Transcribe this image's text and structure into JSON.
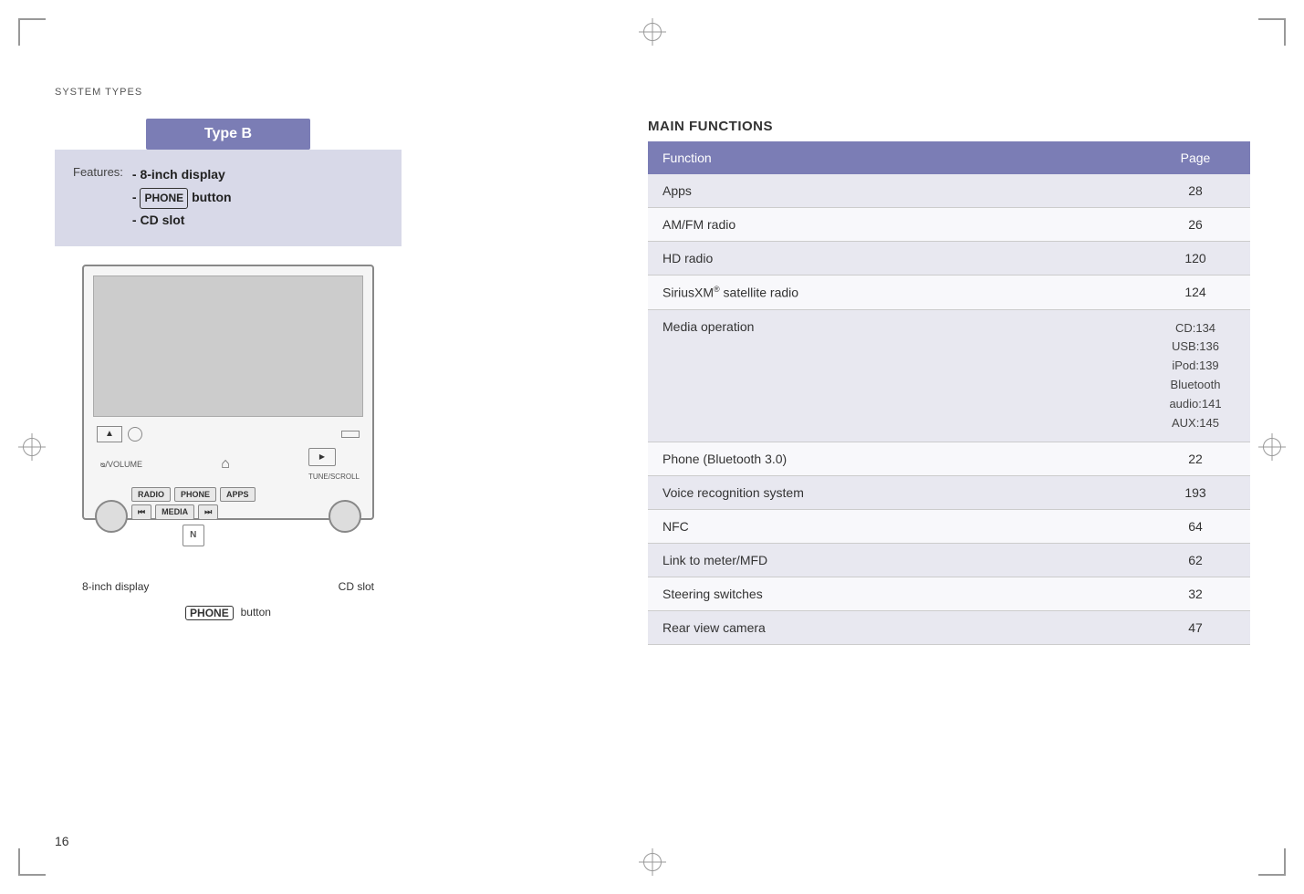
{
  "page": {
    "system_types_label": "SYSTEM TYPES",
    "page_number": "16"
  },
  "left_panel": {
    "type_b_label": "Type B",
    "features_label": "Features:",
    "feature_1": "- 8-inch display",
    "feature_2_pre": "-",
    "feature_2_badge": "PHONE",
    "feature_2_post": "button",
    "feature_3": "- CD slot",
    "controls": {
      "vol_label": "ᴓ/VOLUME",
      "tune_scroll": "TUNE/SCROLL",
      "radio_btn": "RADIO",
      "phone_btn": "PHONE",
      "apps_btn": "APPS",
      "prev_btn": "⏮",
      "media_btn": "MEDIA",
      "next_btn": "⏭",
      "nfc_label": "N"
    },
    "diagram_labels": {
      "left": "8-inch display",
      "center_badge": "PHONE",
      "center_text": "button",
      "right": "CD slot"
    }
  },
  "right_panel": {
    "title": "MAIN FUNCTIONS",
    "table": {
      "headers": [
        "Function",
        "Page"
      ],
      "rows": [
        {
          "function": "Apps",
          "page": "28",
          "sub": ""
        },
        {
          "function": "AM/FM radio",
          "page": "26",
          "sub": ""
        },
        {
          "function": "HD radio",
          "page": "120",
          "sub": ""
        },
        {
          "function": "SiriusXM® satellite radio",
          "page": "124",
          "sub": ""
        },
        {
          "function": "Media operation",
          "page": "",
          "sub": "CD:134   USB:136   iPod:139\nBluetooth audio:141   AUX:145"
        },
        {
          "function": "Phone (Bluetooth 3.0)",
          "page": "22",
          "sub": ""
        },
        {
          "function": "Voice recognition system",
          "page": "193",
          "sub": ""
        },
        {
          "function": "NFC",
          "page": "64",
          "sub": ""
        },
        {
          "function": "Link to meter/MFD",
          "page": "62",
          "sub": ""
        },
        {
          "function": "Steering switches",
          "page": "32",
          "sub": ""
        },
        {
          "function": "Rear view camera",
          "page": "47",
          "sub": ""
        }
      ]
    }
  }
}
